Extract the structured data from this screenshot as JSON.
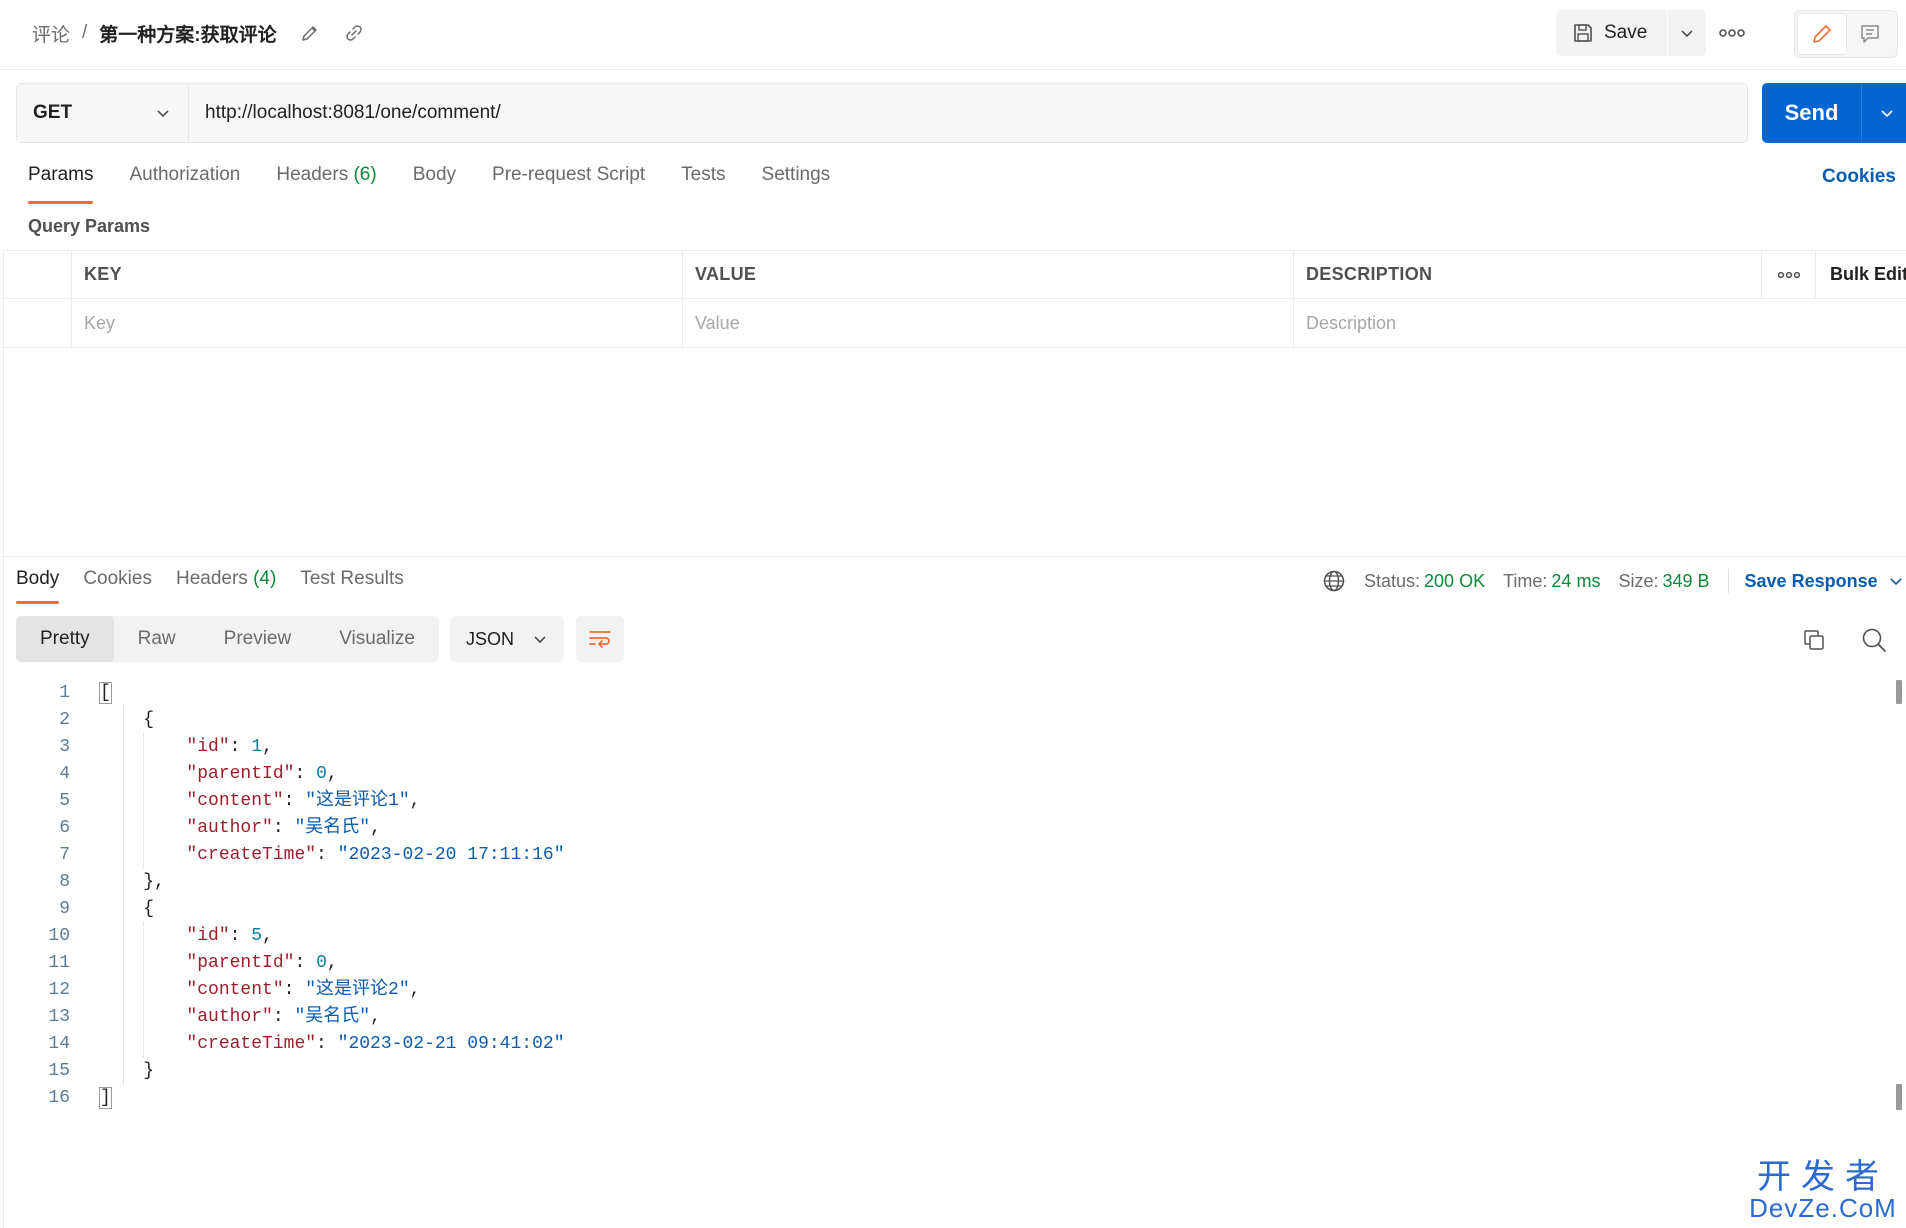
{
  "header": {
    "breadcrumb_parent": "评论",
    "breadcrumb_sep": "/",
    "breadcrumb_current": "第一种方案:获取评论",
    "save_label": "Save"
  },
  "request": {
    "method": "GET",
    "url": "http://localhost:8081/one/comment/",
    "send_label": "Send"
  },
  "request_tabs": [
    {
      "label": "Params"
    },
    {
      "label": "Authorization"
    },
    {
      "label": "Headers",
      "count": "(6)"
    },
    {
      "label": "Body"
    },
    {
      "label": "Pre-request Script"
    },
    {
      "label": "Tests"
    },
    {
      "label": "Settings"
    }
  ],
  "cookies_label": "Cookies",
  "query_params": {
    "title": "Query Params",
    "headers": {
      "key": "KEY",
      "value": "VALUE",
      "description": "DESCRIPTION",
      "bulk_edit": "Bulk Edit"
    },
    "placeholders": {
      "key": "Key",
      "value": "Value",
      "description": "Description"
    }
  },
  "response_tabs": [
    {
      "label": "Body"
    },
    {
      "label": "Cookies"
    },
    {
      "label": "Headers",
      "count": "(4)"
    },
    {
      "label": "Test Results"
    }
  ],
  "response_status": {
    "status_label": "Status:",
    "status_value": "200 OK",
    "time_label": "Time:",
    "time_value": "24 ms",
    "size_label": "Size:",
    "size_value": "349 B",
    "save_response_label": "Save Response"
  },
  "view_options": [
    "Pretty",
    "Raw",
    "Preview",
    "Visualize"
  ],
  "format": "JSON",
  "response_body": {
    "line_numbers": [
      "1",
      "2",
      "3",
      "4",
      "5",
      "6",
      "7",
      "8",
      "9",
      "10",
      "11",
      "12",
      "13",
      "14",
      "15",
      "16"
    ],
    "open_bracket": "[",
    "close_bracket": "]",
    "open_brace": "{",
    "close_brace_comma": "},",
    "close_brace": "}",
    "items": [
      {
        "id": "1",
        "parentId": "0",
        "content": "\"这是评论1\"",
        "author": "\"吴名氏\"",
        "createTime": "\"2023-02-20 17:11:16\""
      },
      {
        "id": "5",
        "parentId": "0",
        "content": "\"这是评论2\"",
        "author": "\"吴名氏\"",
        "createTime": "\"2023-02-21 09:41:02\""
      }
    ],
    "keys": {
      "id": "\"id\"",
      "parentId": "\"parentId\"",
      "content": "\"content\"",
      "author": "\"author\"",
      "createTime": "\"createTime\""
    }
  },
  "watermark": {
    "top": "开发者",
    "bottom": "DevZe.CoM"
  },
  "colors": {
    "accent": "#f26b3a",
    "send": "#0265d2",
    "status_ok": "#0b8a3a",
    "link": "#0b5cad"
  }
}
